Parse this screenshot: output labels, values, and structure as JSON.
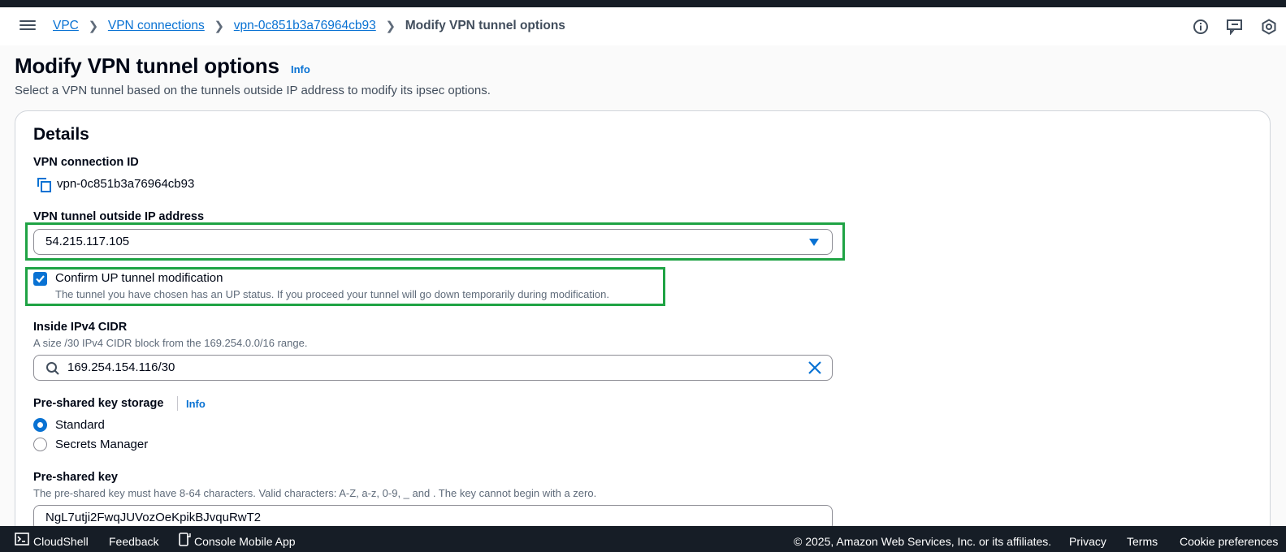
{
  "breadcrumbs": {
    "items": [
      "VPC",
      "VPN connections",
      "vpn-0c851b3a76964cb93"
    ],
    "current": "Modify VPN tunnel options"
  },
  "page": {
    "title": "Modify VPN tunnel options",
    "info": "Info",
    "description": "Select a VPN tunnel based on the tunnels outside IP address to modify its ipsec options."
  },
  "details": {
    "title": "Details",
    "connection_id_label": "VPN connection ID",
    "connection_id": "vpn-0c851b3a76964cb93",
    "outside_ip_label": "VPN tunnel outside IP address",
    "outside_ip": "54.215.117.105",
    "confirm_label": "Confirm UP tunnel modification",
    "confirm_desc": "The tunnel you have chosen has an UP status. If you proceed your tunnel will go down temporarily during modification.",
    "confirm_checked": true,
    "cidr_label": "Inside IPv4 CIDR",
    "cidr_hint": "A size /30 IPv4 CIDR block from the 169.254.0.0/16 range.",
    "cidr_value": "169.254.154.116/30",
    "storage_label": "Pre-shared key storage",
    "storage_info": "Info",
    "storage_options": [
      "Standard",
      "Secrets Manager"
    ],
    "storage_selected": "Standard",
    "psk_label": "Pre-shared key",
    "psk_hint": "The pre-shared key must have 8-64 characters. Valid characters: A-Z, a-z, 0-9, _ and . The key cannot begin with a zero.",
    "psk_value": "NgL7utji2FwqJUVozOeKpikBJvquRwT2"
  },
  "footer": {
    "cloudshell": "CloudShell",
    "feedback": "Feedback",
    "mobile_app": "Console Mobile App",
    "copyright": "© 2025, Amazon Web Services, Inc. or its affiliates.",
    "privacy": "Privacy",
    "terms": "Terms",
    "cookies": "Cookie preferences"
  },
  "colors": {
    "link": "#0972d3",
    "highlight": "#1fa344",
    "footer_bg": "#161d26"
  }
}
